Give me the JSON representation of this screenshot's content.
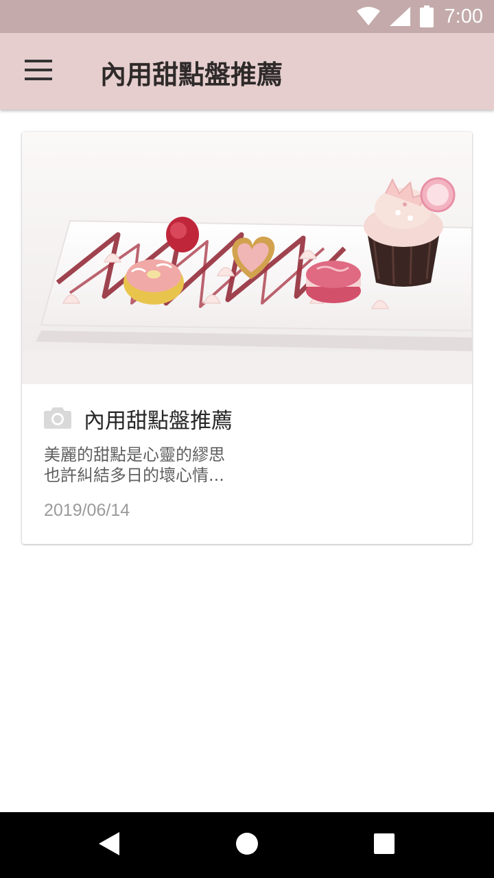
{
  "status_bar": {
    "time": "7:00",
    "icons": [
      "wifi-icon",
      "cell-signal-icon",
      "battery-icon"
    ]
  },
  "app_bar": {
    "title": "內用甜點盤推薦",
    "menu_icon": "menu-icon",
    "background": "#e6cece"
  },
  "card": {
    "image_subject": "dessert plate with macarons, donut, heart tart and cupcake",
    "icon": "camera-icon",
    "title": "內用甜點盤推薦",
    "description": [
      "美麗的甜點是心靈的繆思",
      "也許糾結多日的壞心情..."
    ],
    "date": "2019/06/14"
  },
  "nav_bar": {
    "back_icon": "back-icon",
    "home_icon": "home-icon",
    "recents_icon": "recents-icon"
  },
  "colors": {
    "status_bar": "#c4aaaa",
    "app_bar": "#e6cece",
    "title_text": "#2f2a2a",
    "date_text": "#9a9a9a"
  }
}
